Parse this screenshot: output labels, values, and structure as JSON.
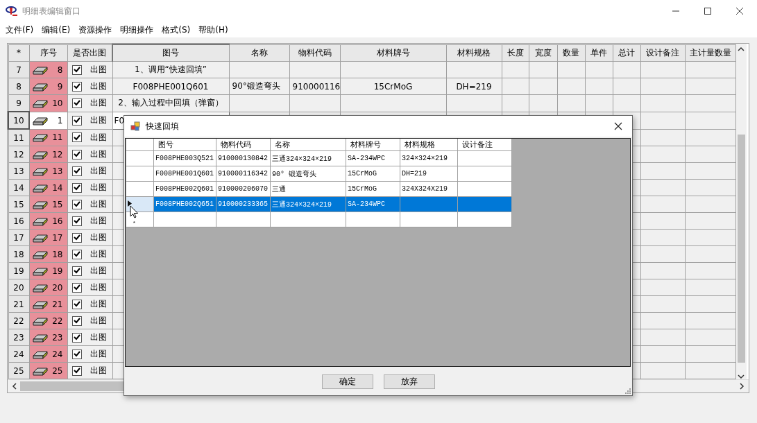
{
  "window": {
    "title": "明细表编辑窗口"
  },
  "menu": [
    "文件(F)",
    "编辑(E)",
    "资源操作",
    "明细操作",
    "格式(S)",
    "帮助(H)"
  ],
  "grid": {
    "corner": "*",
    "seq_column": "序号",
    "check_column": "是否出图",
    "columns": [
      "图号",
      "名称",
      "物料代码",
      "材料牌号",
      "材料规格",
      "长度",
      "宽度",
      "数量",
      "单件",
      "总计",
      "设计备注",
      "主计量数量"
    ],
    "rows": [
      {
        "row": "7",
        "seq": "8",
        "highlighted": true,
        "checked": true,
        "draw": "出图",
        "current": false,
        "cells": [
          "1、调用“快速回填”",
          "",
          "",
          "",
          "",
          "",
          "",
          "",
          "",
          "",
          "",
          "",
          ""
        ]
      },
      {
        "row": "8",
        "seq": "9",
        "highlighted": true,
        "checked": true,
        "draw": "出图",
        "current": false,
        "cells": [
          "F008PHE001Q601",
          "90°锻造弯头",
          "910000116",
          "15CrMoG",
          "DH=219",
          "",
          "",
          "",
          "",
          "",
          "",
          "",
          ""
        ]
      },
      {
        "row": "9",
        "seq": "10",
        "highlighted": true,
        "checked": true,
        "draw": "出图",
        "current": false,
        "cells": [
          "2、输入过程中回填（弹窗）",
          "",
          "",
          "",
          "",
          "",
          "",
          "",
          "",
          "",
          "",
          "",
          ""
        ]
      },
      {
        "row": "10",
        "seq": "1",
        "highlighted": false,
        "checked": true,
        "draw": "出图",
        "current": true,
        "cells": [
          "F0",
          "",
          "",
          "",
          "",
          "",
          "",
          "",
          "",
          "",
          "",
          "",
          ""
        ]
      },
      {
        "row": "11",
        "seq": "11",
        "highlighted": true,
        "checked": true,
        "draw": "出图",
        "current": false,
        "cells": []
      },
      {
        "row": "12",
        "seq": "12",
        "highlighted": true,
        "checked": true,
        "draw": "出图",
        "current": false,
        "cells": []
      },
      {
        "row": "13",
        "seq": "13",
        "highlighted": true,
        "checked": true,
        "draw": "出图",
        "current": false,
        "cells": []
      },
      {
        "row": "14",
        "seq": "14",
        "highlighted": true,
        "checked": true,
        "draw": "出图",
        "current": false,
        "cells": []
      },
      {
        "row": "15",
        "seq": "15",
        "highlighted": true,
        "checked": true,
        "draw": "出图",
        "current": false,
        "cells": []
      },
      {
        "row": "16",
        "seq": "16",
        "highlighted": true,
        "checked": true,
        "draw": "出图",
        "current": false,
        "cells": []
      },
      {
        "row": "17",
        "seq": "17",
        "highlighted": true,
        "checked": true,
        "draw": "出图",
        "current": false,
        "cells": []
      },
      {
        "row": "18",
        "seq": "18",
        "highlighted": true,
        "checked": true,
        "draw": "出图",
        "current": false,
        "cells": []
      },
      {
        "row": "19",
        "seq": "19",
        "highlighted": true,
        "checked": true,
        "draw": "出图",
        "current": false,
        "cells": []
      },
      {
        "row": "20",
        "seq": "20",
        "highlighted": true,
        "checked": true,
        "draw": "出图",
        "current": false,
        "cells": []
      },
      {
        "row": "21",
        "seq": "21",
        "highlighted": true,
        "checked": true,
        "draw": "出图",
        "current": false,
        "cells": []
      },
      {
        "row": "22",
        "seq": "22",
        "highlighted": true,
        "checked": true,
        "draw": "出图",
        "current": false,
        "cells": []
      },
      {
        "row": "23",
        "seq": "23",
        "highlighted": true,
        "checked": true,
        "draw": "出图",
        "current": false,
        "cells": []
      },
      {
        "row": "24",
        "seq": "24",
        "highlighted": true,
        "checked": true,
        "draw": "出图",
        "current": false,
        "cells": []
      },
      {
        "row": "25",
        "seq": "25",
        "highlighted": true,
        "checked": true,
        "draw": "出图",
        "current": false,
        "cells": []
      }
    ]
  },
  "dialog": {
    "title": "快速回填",
    "columns": [
      "图号",
      "物料代码",
      "名称",
      "材料牌号",
      "材料规格",
      "设计备注"
    ],
    "rows": [
      {
        "selected": false,
        "cells": [
          "F008PHE003Q521",
          "910000130842",
          "三通324×324×219",
          "SA-234WPC",
          "324×324×219",
          ""
        ]
      },
      {
        "selected": false,
        "cells": [
          "F008PHE001Q601",
          "910000116342",
          "90° 锻造弯头",
          "15CrMoG",
          "DH=219",
          ""
        ]
      },
      {
        "selected": false,
        "cells": [
          "F008PHE002Q601",
          "910000206070",
          "三通",
          "15CrMoG",
          "324X324X219",
          ""
        ]
      },
      {
        "selected": true,
        "cells": [
          "F008PHE002Q651",
          "910000233365",
          "三通324×324×219",
          "SA-234WPC",
          "",
          ""
        ]
      }
    ],
    "new_row_marker": "*",
    "buttons": [
      "确定",
      "放弃"
    ]
  }
}
